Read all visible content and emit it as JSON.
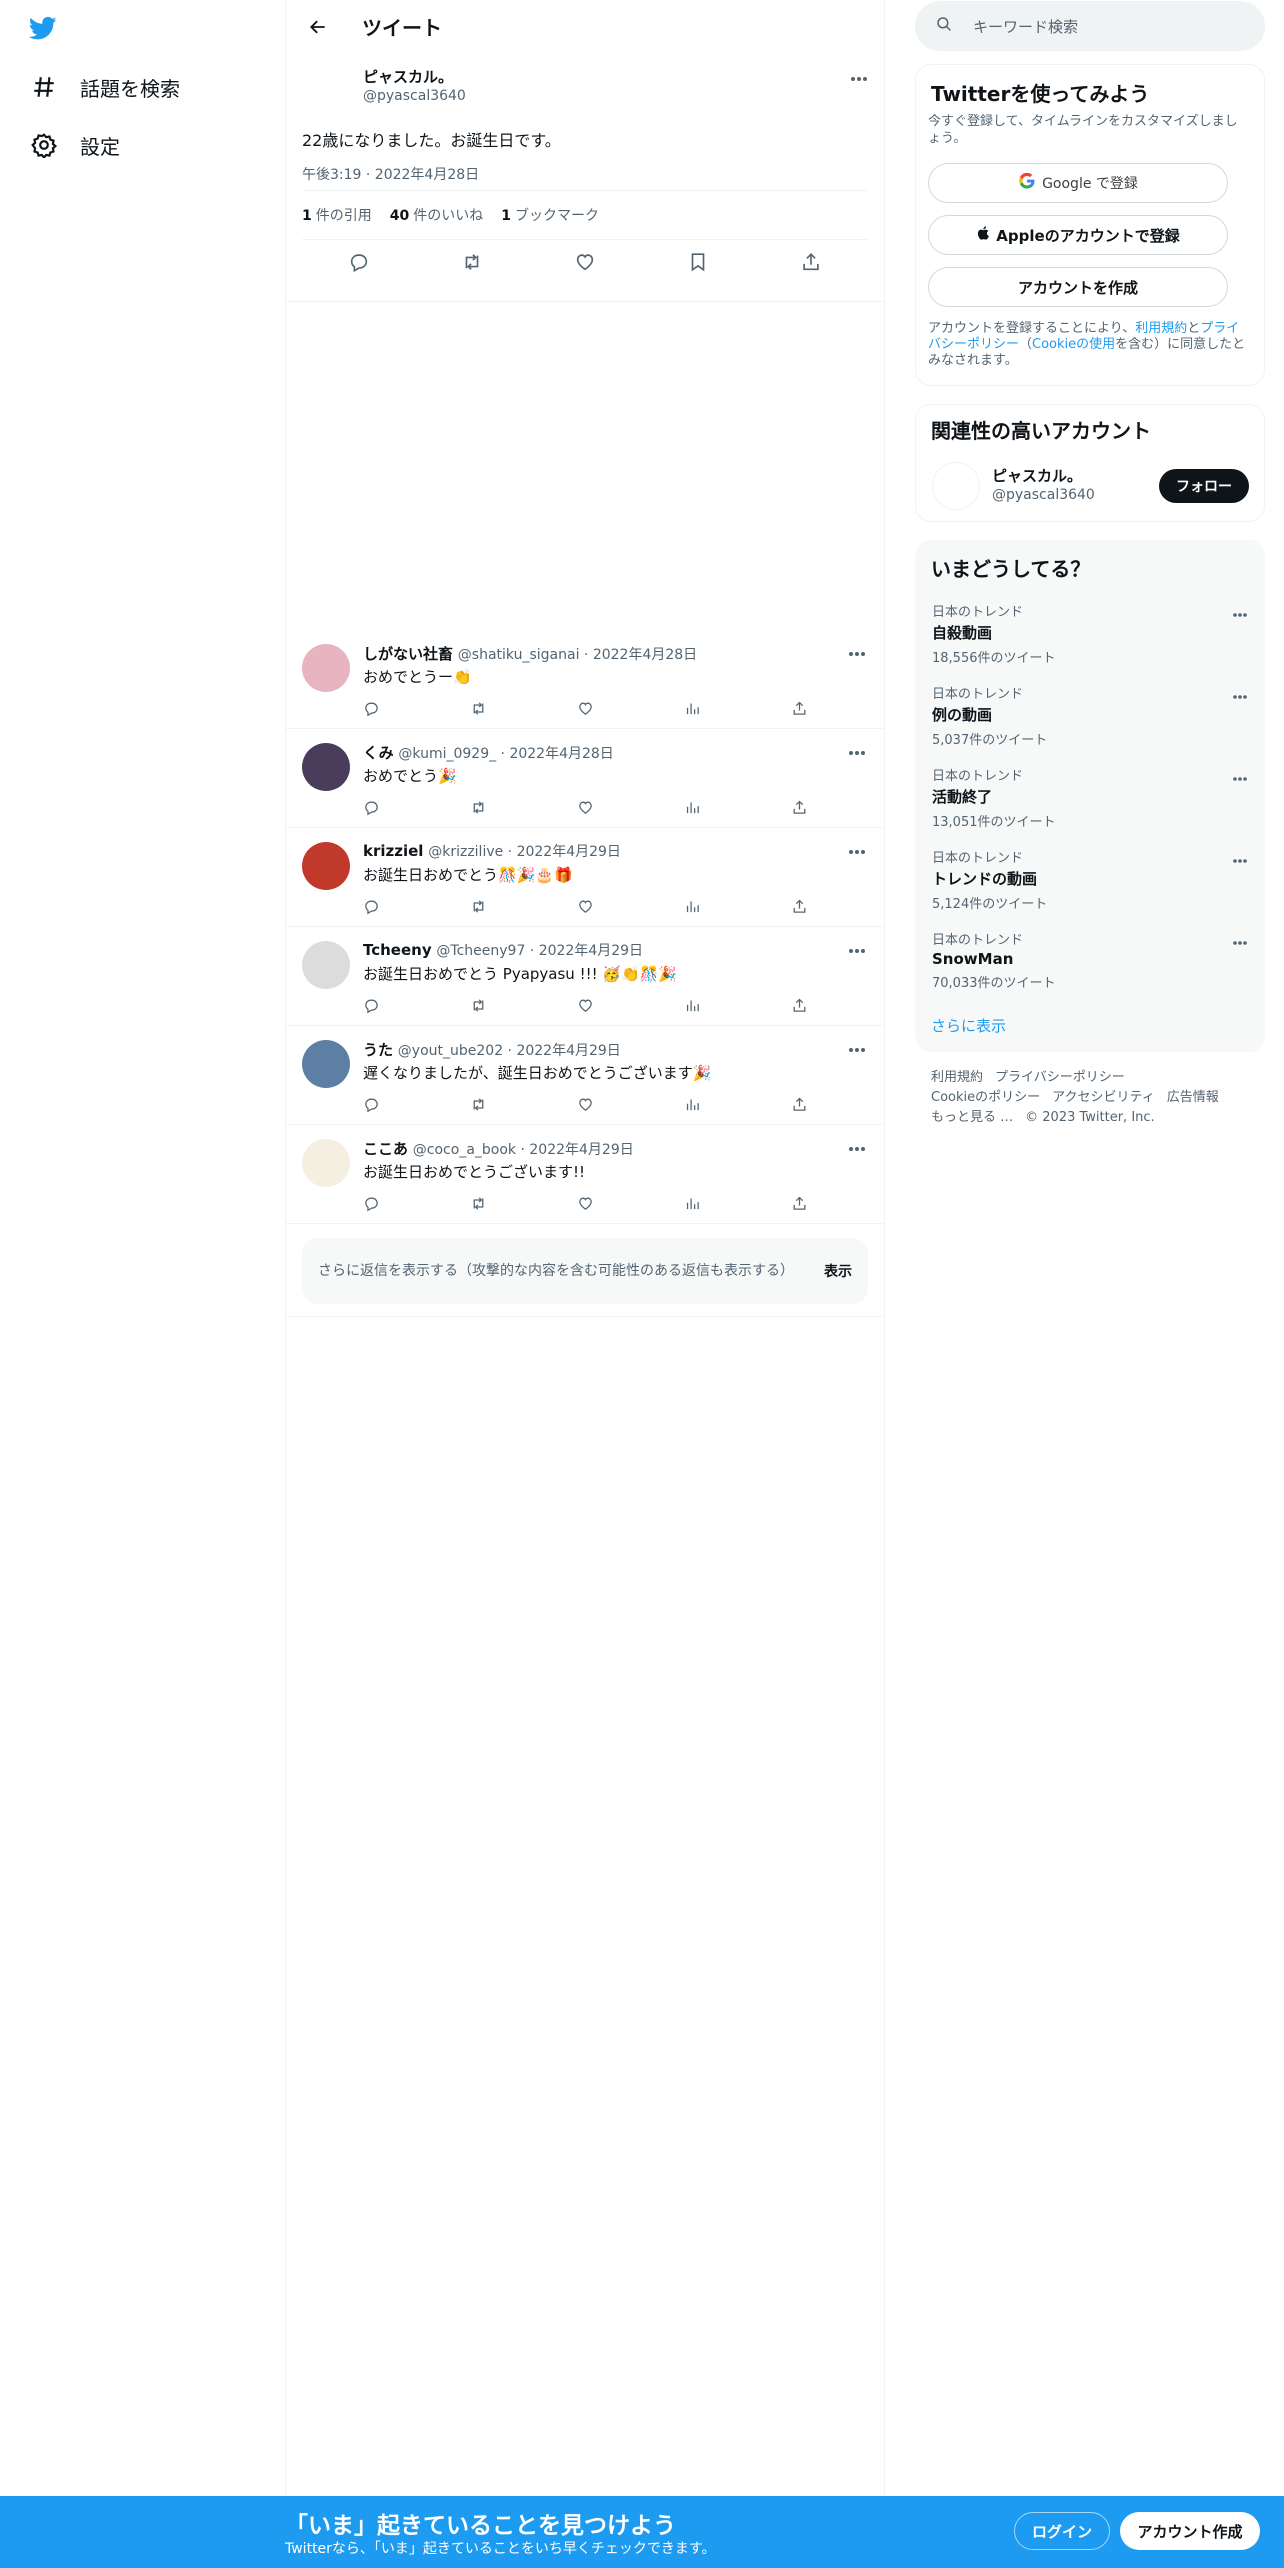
{
  "nav": {
    "explore": "話題を検索",
    "settings": "設定"
  },
  "header": {
    "title": "ツイート"
  },
  "tweet": {
    "name": "ピャスカル。",
    "handle": "@pyascal3640",
    "text": "22歳になりました。お誕生日です。",
    "time": "午後3:19 · 2022年4月28日",
    "quotes_count": "1",
    "quotes_label": "件の引用",
    "likes_count": "40",
    "likes_label": "件のいいね",
    "bookmarks_count": "1",
    "bookmarks_label": "ブックマーク"
  },
  "replies": [
    {
      "name": "しがない社畜",
      "handle": "@shatiku_siganai · 2022年4月28日",
      "text": "おめでとうー👏",
      "avatar_color": "#e8b4c0"
    },
    {
      "name": "くみ",
      "handle": "@kumi_0929_ · 2022年4月28日",
      "text": "おめでとう🎉",
      "avatar_color": "#4a3d5c"
    },
    {
      "name": "krizziel",
      "handle": "@krizzilive · 2022年4月29日",
      "text": "お誕生日おめでとう🎊🎉🎂🎁",
      "avatar_color": "#c0392b"
    },
    {
      "name": "Tcheeny",
      "handle": "@Tcheeny97 · 2022年4月29日",
      "text": "お誕生日おめでとう Pyapyasu !!! 🥳👏🎊🎉",
      "avatar_color": "#dcdcdc"
    },
    {
      "name": "うた",
      "handle": "@yout_ube202 · 2022年4月29日",
      "text": "遅くなりましたが、誕生日おめでとうございます🎉",
      "avatar_color": "#5d7fa3"
    },
    {
      "name": "ここあ",
      "handle": "@coco_a_book · 2022年4月29日",
      "text": "お誕生日おめでとうございます!!",
      "avatar_color": "#f4efe0"
    }
  ],
  "show_more": {
    "text": "さらに返信を表示する（攻撃的な内容を含む可能性のある返信も表示する）",
    "button": "表示"
  },
  "search": {
    "placeholder": "キーワード検索"
  },
  "signup_box": {
    "title": "Twitterを使ってみよう",
    "subtitle": "今すぐ登録して、タイムラインをカスタマイズしましょう。",
    "google": "Google で登録",
    "apple": "Appleのアカウントで登録",
    "create": "アカウントを作成",
    "legal_1": "アカウントを登録することにより、",
    "legal_terms": "利用規約",
    "legal_2": "と",
    "legal_privacy": "プライバシーポリシー",
    "legal_3": "（",
    "legal_cookie": "Cookieの使用",
    "legal_4": "を含む）に同意したとみなされます。"
  },
  "related": {
    "title": "関連性の高いアカウント",
    "name": "ピャスカル。",
    "handle": "@pyascal3640",
    "follow": "フォロー"
  },
  "trends": {
    "title": "いまどうしてる？",
    "items": [
      {
        "category": "日本のトレンド",
        "name": "自殺動画",
        "count": "18,556件のツイート"
      },
      {
        "category": "日本のトレンド",
        "name": "例の動画",
        "count": "5,037件のツイート"
      },
      {
        "category": "日本のトレンド",
        "name": "活動終了",
        "count": "13,051件のツイート"
      },
      {
        "category": "日本のトレンド",
        "name": "トレンドの動画",
        "count": "5,124件のツイート"
      },
      {
        "category": "日本のトレンド",
        "name": "SnowMan",
        "count": "70,033件のツイート"
      }
    ],
    "show_more": "さらに表示"
  },
  "footer": {
    "terms": "利用規約",
    "privacy": "プライバシーポリシー",
    "cookie": "Cookieのポリシー",
    "accessibility": "アクセシビリティ",
    "ads": "広告情報",
    "more": "もっと見る …",
    "copyright": "© 2023 Twitter, Inc."
  },
  "bottom_bar": {
    "headline": "「いま」起きていることを見つけよう",
    "sub": "Twitterなら、「いま」起きていることをいち早くチェックできます。",
    "login": "ログイン",
    "signup": "アカウント作成"
  },
  "colors": {
    "brand": "#1d9bf0",
    "text": "#0f1419",
    "muted": "#536471"
  }
}
